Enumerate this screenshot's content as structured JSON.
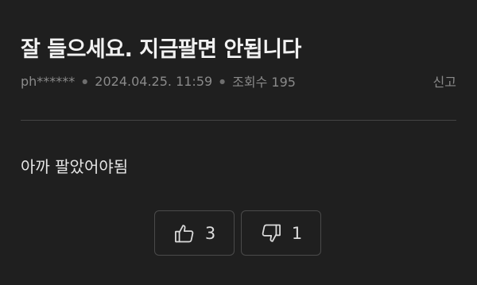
{
  "post": {
    "title": "잘 들으세요. 지금팔면 안됩니다",
    "author": "ph******",
    "date": "2024.04.25. 11:59",
    "views": "조회수 195",
    "report_label": "신고",
    "body": "아까 팔았어야됨"
  },
  "votes": {
    "like_count": "3",
    "dislike_count": "1",
    "like_icon": "thumbs-up-icon",
    "dislike_icon": "thumbs-down-icon"
  },
  "colors": {
    "background": "#1f1f1f",
    "text": "#e8e8e8",
    "meta": "#8a8a8a",
    "border": "#4a4a4a"
  }
}
